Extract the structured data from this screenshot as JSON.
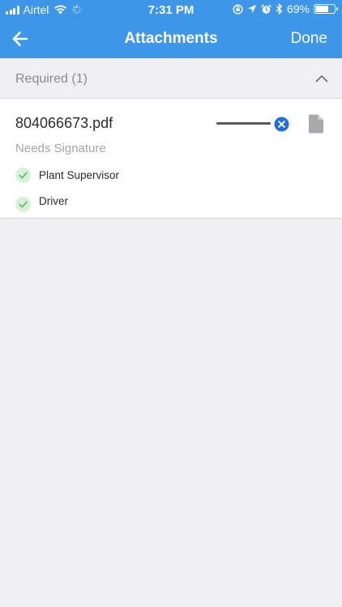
{
  "status_bar": {
    "carrier": "Airtel",
    "time": "7:31 PM",
    "battery_percent": "69%",
    "battery_level": 0.69,
    "icons": [
      "signal-icon",
      "wifi-icon",
      "activity-spinner-icon",
      "screen-rotation-lock-icon",
      "location-icon",
      "alarm-icon",
      "bluetooth-icon",
      "battery-icon"
    ]
  },
  "nav": {
    "back_icon": "arrow-left-icon",
    "title": "Attachments",
    "done_label": "Done"
  },
  "section": {
    "title": "Required (1)",
    "toggle_icon": "chevron-up-icon"
  },
  "attachment": {
    "file_name": "804066673.pdf",
    "status": "Needs Signature",
    "progress": 1.0,
    "cancel_icon": "close-circle-icon",
    "doc_icon": "document-icon",
    "signers": [
      {
        "name": "Plant Supervisor",
        "icon": "check-circle-icon"
      },
      {
        "name": "Driver",
        "icon": "check-circle-icon"
      }
    ]
  },
  "colors": {
    "brand_blue": "#3d96e8",
    "cancel_blue": "#1e6fe0",
    "check_green": "#63c66c",
    "check_bg": "#d9f1db",
    "background": "#efeff4"
  }
}
